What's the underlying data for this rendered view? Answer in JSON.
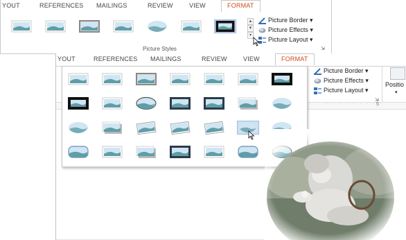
{
  "ribbon_top": {
    "tabs": [
      "YOUT",
      "REFERENCES",
      "MAILINGS",
      "REVIEW",
      "VIEW",
      "FORMAT"
    ],
    "commands": {
      "picture_border": "Picture Border",
      "picture_effects": "Picture Effects",
      "picture_layout": "Picture Layout"
    },
    "group_label": "Picture Styles"
  },
  "ribbon_bottom": {
    "tabs": [
      "YOUT",
      "REFERENCES",
      "MAILINGS",
      "REVIEW",
      "VIEW",
      "FORMAT"
    ],
    "commands": {
      "picture_border": "Picture Border",
      "picture_effects": "Picture Effects",
      "picture_layout": "Picture Layout",
      "position": "Positio"
    }
  },
  "ruler_mark": "5",
  "colors": {
    "accent": "#d04a1a",
    "selection": "#cfe0f3",
    "sky": "#cfe6f2",
    "hill": "#5f9ea8",
    "border": "#c8c8c8"
  }
}
